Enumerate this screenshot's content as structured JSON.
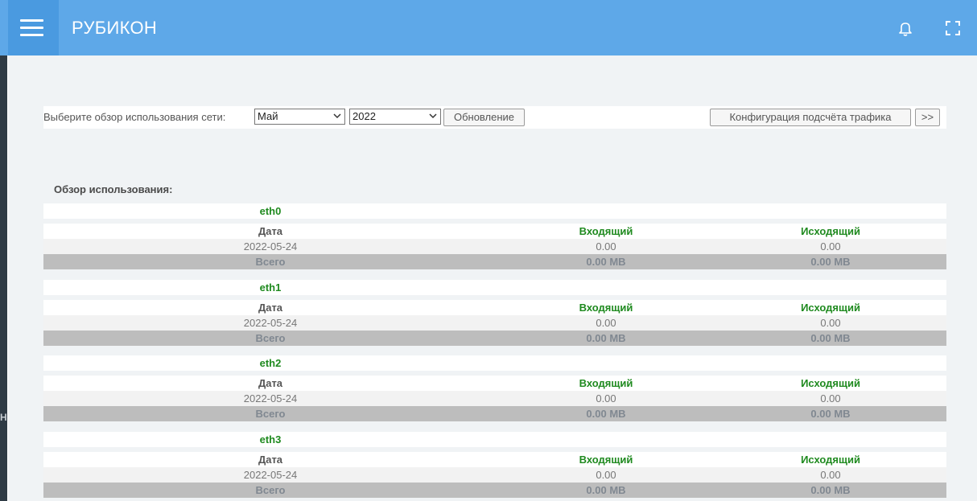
{
  "header": {
    "brand": "РУБИКОН",
    "icons": [
      "menu-icon",
      "bell-icon",
      "fullscreen-icon"
    ]
  },
  "left_strip": {
    "letter": "Н"
  },
  "toolbar": {
    "label": "Выберите обзор использования сети:",
    "month_value": "Май",
    "year_value": "2022",
    "refresh_label": "Обновление",
    "config_label": "Конфигурация подсчёта трафика",
    "next_label": ">>"
  },
  "usage": {
    "title": "Обзор использования:",
    "columns": {
      "date": "Дата",
      "incoming": "Входящий",
      "outgoing": "Исходящий"
    },
    "interfaces": [
      {
        "name": "eth0",
        "rows": [
          {
            "date": "2022-05-24",
            "incoming": "0.00",
            "outgoing": "0.00"
          }
        ],
        "total_label": "Всего",
        "total_in": "0.00 MB",
        "total_out": "0.00 MB"
      },
      {
        "name": "eth1",
        "rows": [
          {
            "date": "2022-05-24",
            "incoming": "0.00",
            "outgoing": "0.00"
          }
        ],
        "total_label": "Всего",
        "total_in": "0.00 MB",
        "total_out": "0.00 MB"
      },
      {
        "name": "eth2",
        "rows": [
          {
            "date": "2022-05-24",
            "incoming": "0.00",
            "outgoing": "0.00"
          }
        ],
        "total_label": "Всего",
        "total_in": "0.00 MB",
        "total_out": "0.00 MB"
      },
      {
        "name": "eth3",
        "rows": [
          {
            "date": "2022-05-24",
            "incoming": "0.00",
            "outgoing": "0.00"
          }
        ],
        "total_label": "Всего",
        "total_in": "0.00 MB",
        "total_out": "0.00 MB"
      }
    ]
  },
  "colors": {
    "header": "#5ea8e8",
    "menu_button": "#4a9ae0",
    "interface_name": "#1f8a1f",
    "total_row": "#bdbdbd"
  }
}
